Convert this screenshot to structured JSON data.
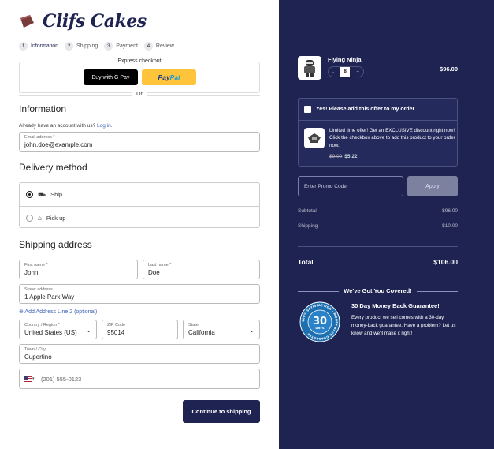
{
  "brand": {
    "name": "Clifs Cakes"
  },
  "steps": [
    {
      "num": "1",
      "label": "Information"
    },
    {
      "num": "2",
      "label": "Shipping"
    },
    {
      "num": "3",
      "label": "Payment"
    },
    {
      "num": "4",
      "label": "Review"
    }
  ],
  "express": {
    "title": "Express checkout",
    "gpay_label": "Buy with G Pay",
    "paypal_a": "Pay",
    "paypal_b": "Pal",
    "or": "Or"
  },
  "information": {
    "heading": "Information",
    "note": "Already have an account with us?",
    "login": "Log in.",
    "email_label": "Email address *",
    "email_value": "john.doe@example.com"
  },
  "delivery": {
    "heading": "Delivery method",
    "options": [
      {
        "label": "Ship",
        "selected": true
      },
      {
        "label": "Pick up",
        "selected": false
      }
    ]
  },
  "shipping": {
    "heading": "Shipping address",
    "first_name_label": "First name *",
    "first_name": "John",
    "last_name_label": "Last name *",
    "last_name": "Doe",
    "street_label": "Street address",
    "street": "1 Apple Park Way",
    "add_line": "⊕ Add Address Line 2 (optional)",
    "country_label": "Country / Region *",
    "country": "United States (US)",
    "zip_label": "ZIP Code",
    "zip": "95014",
    "state_label": "State",
    "state": "California",
    "city_label": "Town / City",
    "city": "Cupertino",
    "phone_placeholder": "(201) 555-0123"
  },
  "cta": {
    "label": "Continue to shipping"
  },
  "cart": {
    "product_name": "Flying Ninja",
    "qty": "8",
    "minus": "-",
    "plus": "+",
    "price": "$96.00"
  },
  "offer": {
    "checkbox_label": "Yes! Please add this offer to my order",
    "text": "Limited time offer! Get an EXCLUSIVE discount right now! Click the checkbox above to add this product to your order now.",
    "old_price": "$9.00",
    "new_price": "$5.22"
  },
  "promo": {
    "placeholder": "Enter Promo Code",
    "apply": "Apply"
  },
  "summary": {
    "subtotal_label": "Subtotal",
    "subtotal": "$96.00",
    "shipping_label": "Shipping",
    "shipping": "$10.00",
    "total_label": "Total",
    "total": "$106.00"
  },
  "guarantee": {
    "heading": "We've Got You Covered!",
    "badge_num": "30",
    "badge_days": "DAYS",
    "badge_ring": "100% SATISFACTION · MONEY BACK GUARANTEE",
    "title": "30 Day Money Back Guarantee!",
    "text": "Every product we sell comes with a 30-day money-back guarantee. Have a problem? Let us know and we'll make it right!"
  },
  "colors": {
    "navy": "#1e2352",
    "paypal_yellow": "#ffc439",
    "link": "#3a5fb8",
    "badge_blue": "#1e6fb0"
  }
}
